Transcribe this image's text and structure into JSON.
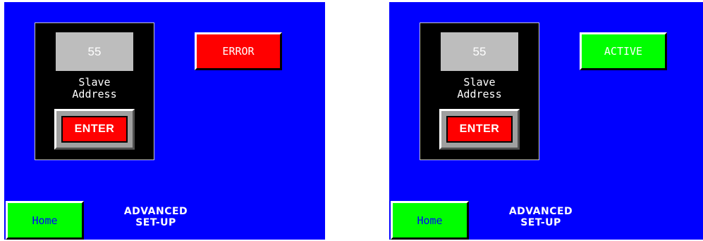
{
  "colors": {
    "screen_bg": "#0000ff",
    "panel_bg": "#000000",
    "value_box_bg": "#bdbdbd",
    "enter_button": "#ff0000",
    "error_button": "#ff0000",
    "active_button": "#00ff00",
    "home_button": "#00ff00",
    "home_text": "#0000ff"
  },
  "screens": [
    {
      "address_value": "55",
      "address_label_line1": "Slave",
      "address_label_line2": "Address",
      "enter_label": "ENTER",
      "status_label": "ERROR",
      "status_color": "#ff0000",
      "home_label": "Home",
      "title_line1": "ADVANCED",
      "title_line2": "SET-UP"
    },
    {
      "address_value": "55",
      "address_label_line1": "Slave",
      "address_label_line2": "Address",
      "enter_label": "ENTER",
      "status_label": "ACTIVE",
      "status_color": "#00ff00",
      "home_label": "Home",
      "title_line1": "ADVANCED",
      "title_line2": "SET-UP"
    }
  ]
}
